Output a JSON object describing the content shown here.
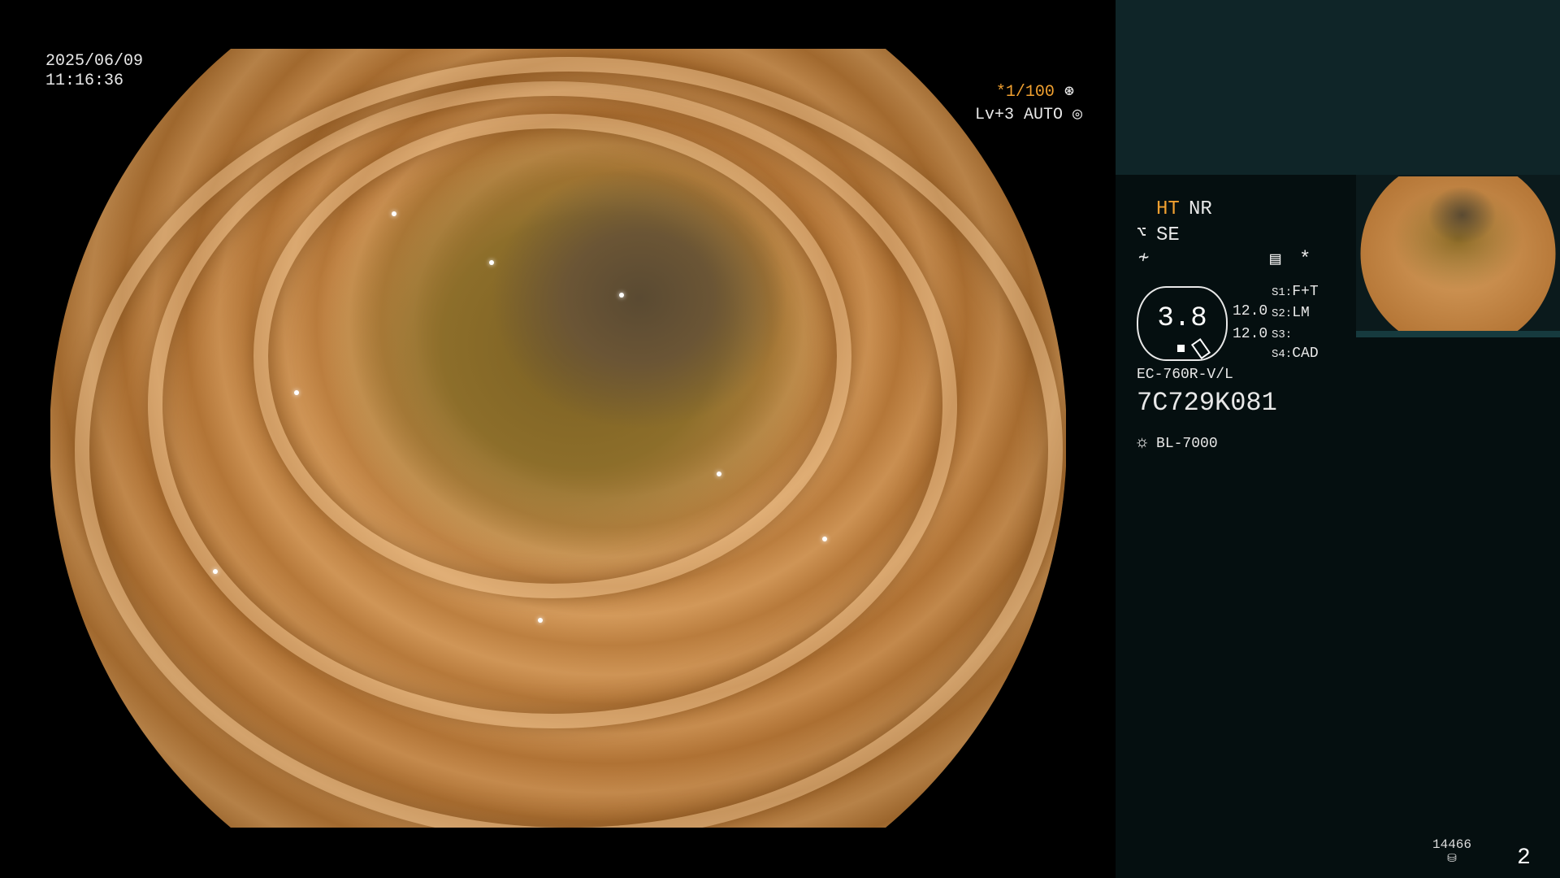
{
  "main": {
    "date": "2025/06/09",
    "time": "11:16:36",
    "shutter": "*1/100",
    "iris": "Lv+3 AUTO"
  },
  "side": {
    "ht": "HT",
    "nr": "NR",
    "se": "SE",
    "zoom_value": "3.8",
    "values": [
      "12.0",
      "12.0"
    ],
    "switches": [
      {
        "key": "S1:",
        "value": "F+T"
      },
      {
        "key": "S2:",
        "value": "LM"
      },
      {
        "key": "S3:",
        "value": ""
      },
      {
        "key": "S4:",
        "value": "CAD"
      }
    ],
    "scope_model": "EC-760R-V/L",
    "scope_serial": "7C729K081",
    "light_source": "BL-7000",
    "storage_count": "14466",
    "page_number": "2"
  },
  "icons": {
    "shutter": "aperture-icon",
    "iris": "iris-icon",
    "structure": "structure-enhance-icon",
    "color": "color-enhance-icon",
    "record": "record-settings-icon",
    "star": "asterisk-icon",
    "light": "light-source-icon",
    "storage": "storage-icon"
  },
  "colors": {
    "accent_orange": "#f0a030",
    "panel_bg": "#050f10",
    "panel_top": "#0f2528"
  }
}
